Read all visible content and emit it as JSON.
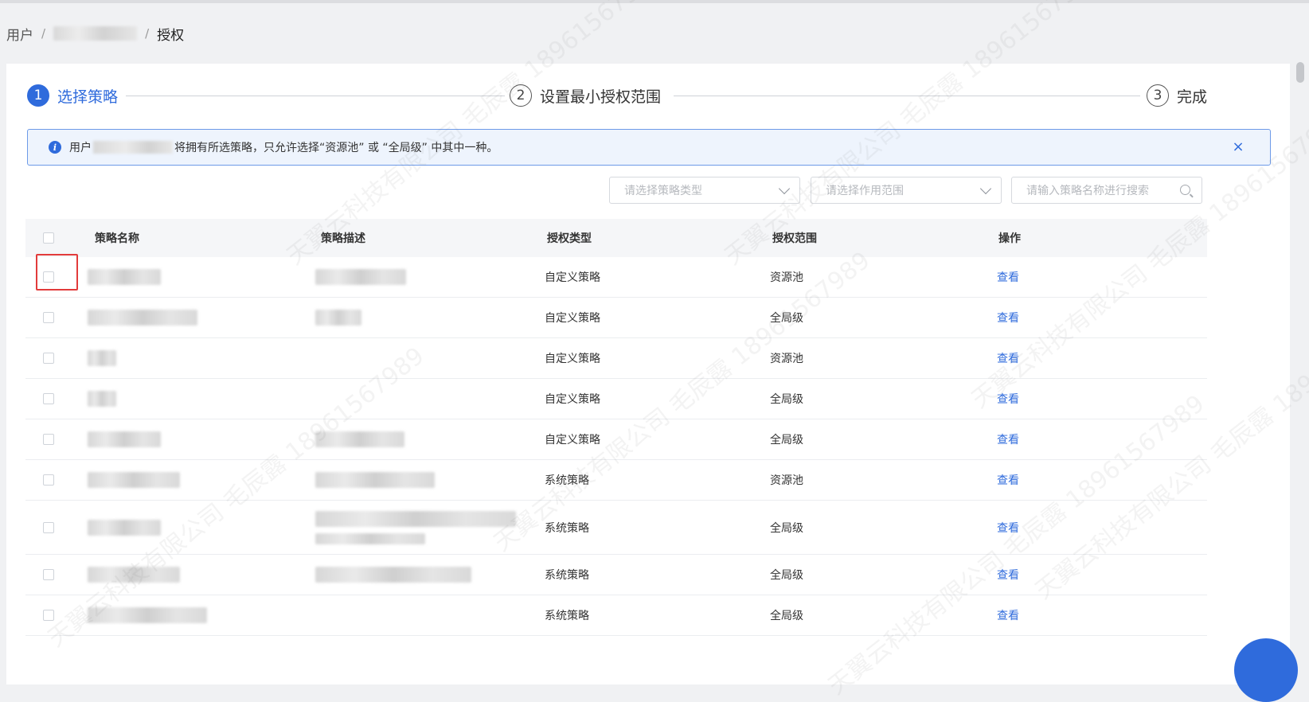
{
  "breadcrumb": {
    "root": "用户",
    "separator": "/",
    "current": "授权"
  },
  "steps": [
    {
      "num": "1",
      "label": "选择策略",
      "state": "active"
    },
    {
      "num": "2",
      "label": "设置最小授权范围",
      "state": "pending"
    },
    {
      "num": "3",
      "label": "完成",
      "state": "pending"
    }
  ],
  "alert": {
    "prefix": "用户",
    "suffix": "将拥有所选策略，只允许选择“资源池” 或 “全局级” 中其中一种。",
    "close_icon": "×"
  },
  "filters": {
    "type_placeholder": "请选择策略类型",
    "scope_placeholder": "请选择作用范围",
    "search_placeholder": "请输入策略名称进行搜索"
  },
  "table": {
    "headers": {
      "name": "策略名称",
      "desc": "策略描述",
      "type": "授权类型",
      "scope": "授权范围",
      "op": "操作"
    },
    "rows": [
      {
        "type": "自定义策略",
        "scope": "资源池",
        "op": "查看"
      },
      {
        "type": "自定义策略",
        "scope": "全局级",
        "op": "查看"
      },
      {
        "type": "自定义策略",
        "scope": "资源池",
        "op": "查看"
      },
      {
        "type": "自定义策略",
        "scope": "全局级",
        "op": "查看"
      },
      {
        "type": "自定义策略",
        "scope": "全局级",
        "op": "查看"
      },
      {
        "type": "系统策略",
        "scope": "资源池",
        "op": "查看"
      },
      {
        "type": "系统策略",
        "scope": "全局级",
        "op": "查看"
      },
      {
        "type": "系统策略",
        "scope": "全局级",
        "op": "查看"
      },
      {
        "type": "系统策略",
        "scope": "全局级",
        "op": "查看"
      }
    ]
  },
  "watermark": "天翼云科技有限公司 毛辰露 18961567989",
  "colors": {
    "accent": "#2f6bdc",
    "alert_bg": "#eef4fd",
    "highlight": "#e23b3b"
  }
}
